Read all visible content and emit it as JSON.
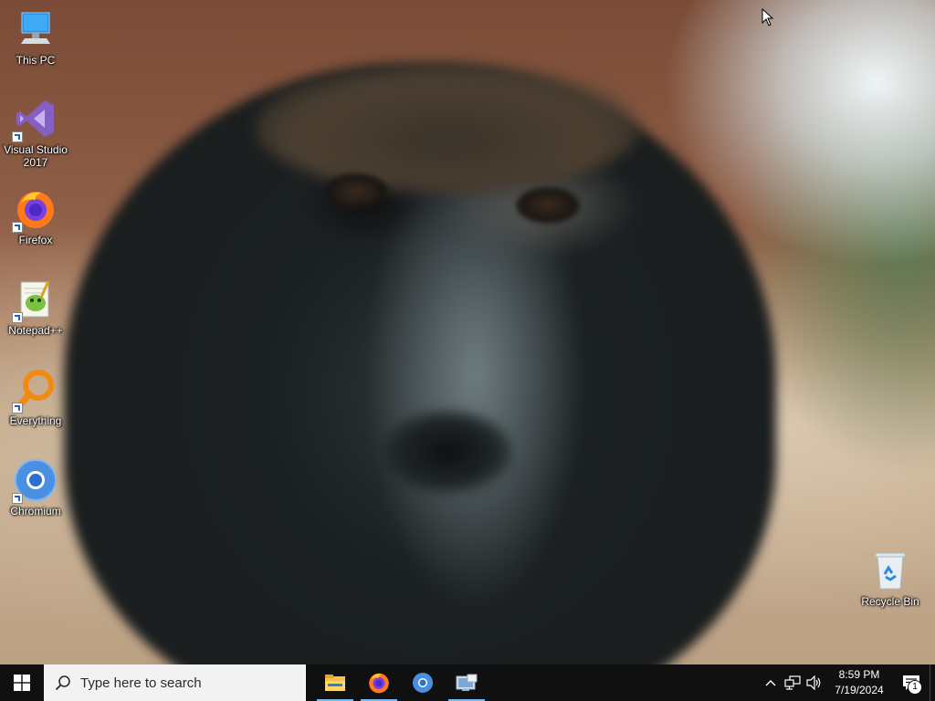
{
  "desktop": {
    "icons": [
      {
        "label": "This PC",
        "icon": "computer-icon"
      },
      {
        "label": "Visual Studio 2017",
        "icon": "visual-studio-icon"
      },
      {
        "label": "Firefox",
        "icon": "firefox-icon"
      },
      {
        "label": "Notepad++",
        "icon": "notepadplusplus-icon"
      },
      {
        "label": "Everything",
        "icon": "everything-search-icon"
      },
      {
        "label": "Chromium",
        "icon": "chromium-icon"
      },
      {
        "label": "Recycle Bin",
        "icon": "recycle-bin-icon"
      }
    ]
  },
  "taskbar": {
    "search_placeholder": "Type here to search",
    "pinned": [
      {
        "name": "File Explorer",
        "icon": "file-explorer-icon"
      },
      {
        "name": "Firefox",
        "icon": "firefox-icon"
      },
      {
        "name": "Chromium",
        "icon": "chromium-icon"
      },
      {
        "name": "Control Panel",
        "icon": "control-panel-icon"
      }
    ],
    "clock": {
      "time": "8:59 PM",
      "date": "7/19/2024"
    },
    "notification_count": "1"
  },
  "colors": {
    "taskbar_bg": "#101010",
    "running_indicator": "#76b9ed",
    "search_bg": "#f2f2f2"
  }
}
